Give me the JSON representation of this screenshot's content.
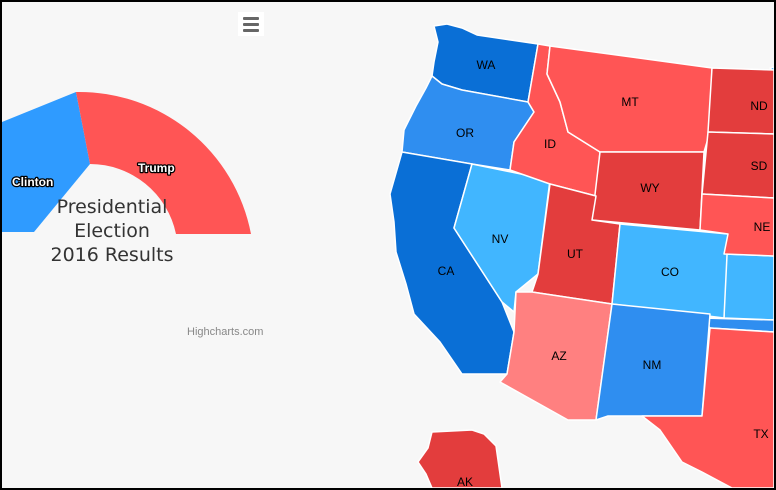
{
  "colors": {
    "clinton": "#2f9bff",
    "trump": "#ff5555",
    "dem_strong": "#0a6fd6",
    "dem_mid": "#2f8ef0",
    "dem_light": "#41b6ff",
    "rep_strong": "#e33d3d",
    "rep_mid": "#ff5555",
    "rep_light": "#ff8080"
  },
  "menu": {
    "icon": "hamburger-menu-icon"
  },
  "chart_data": {
    "type": "pie",
    "variant": "semi-circle donut",
    "title": "Presidential Election 2016 Results",
    "title_lines": [
      "Presidential",
      "Election",
      "2016 Results"
    ],
    "series": [
      {
        "name": "Clinton",
        "color": "#2f9bff"
      },
      {
        "name": "Trump",
        "color": "#ff5555"
      }
    ],
    "credits": "Highcharts.com"
  },
  "map": {
    "states": [
      {
        "code": "WA",
        "color": "#0a6fd6"
      },
      {
        "code": "OR",
        "color": "#2f8ef0"
      },
      {
        "code": "CA",
        "color": "#0a6fd6"
      },
      {
        "code": "NV",
        "color": "#41b6ff"
      },
      {
        "code": "ID",
        "color": "#ff5555"
      },
      {
        "code": "MT",
        "color": "#ff5555"
      },
      {
        "code": "WY",
        "color": "#e33d3d"
      },
      {
        "code": "UT",
        "color": "#e33d3d"
      },
      {
        "code": "CO",
        "color": "#41b6ff"
      },
      {
        "code": "AZ",
        "color": "#ff8080"
      },
      {
        "code": "NM",
        "color": "#2f8ef0"
      },
      {
        "code": "ND",
        "color": "#e33d3d"
      },
      {
        "code": "SD",
        "color": "#e33d3d"
      },
      {
        "code": "NE",
        "color": "#ff5555"
      },
      {
        "code": "TX",
        "color": "#ff5555"
      },
      {
        "code": "AK",
        "color": "#e33d3d"
      }
    ]
  }
}
